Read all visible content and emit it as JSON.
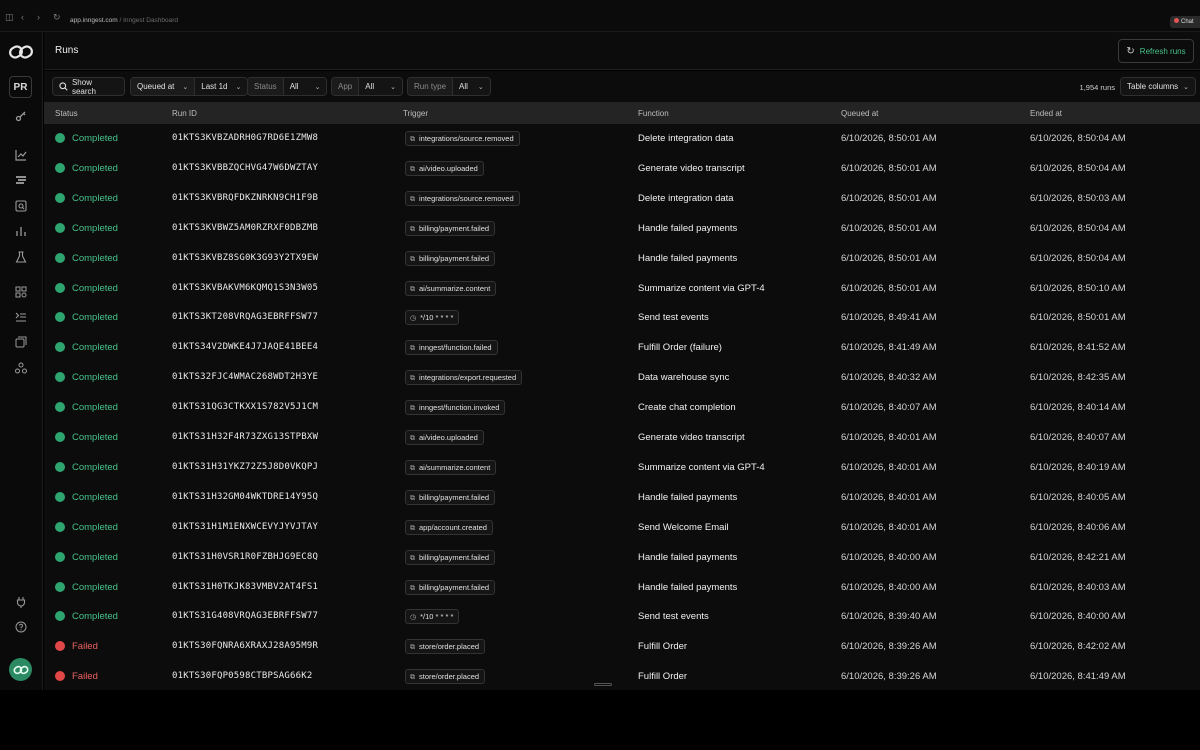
{
  "browser": {
    "url_host": "app.inngest.com",
    "url_sep": " / ",
    "url_title": "Inngest Dashboard",
    "extension_label": "Chat"
  },
  "sidebar": {
    "org_initials": "PR"
  },
  "header": {
    "title": "Runs",
    "refresh_label": "Refresh runs"
  },
  "filters": {
    "show_search": "Show search",
    "queued_at": "Queued at",
    "last": "Last 1d",
    "status_label": "Status",
    "status_value": "All",
    "app_label": "App",
    "app_value": "All",
    "run_type_label": "Run type",
    "run_type_value": "All",
    "runs_count": "1,954 runs",
    "table_columns": "Table columns"
  },
  "colors": {
    "completed": "#2ea56f",
    "failed": "#e04848",
    "completed_text": "#47c28b",
    "failed_text": "#ec6262"
  },
  "table": {
    "columns": [
      "Status",
      "Run ID",
      "Trigger",
      "Function",
      "Queued at",
      "Ended at"
    ],
    "rows": [
      {
        "status": "Completed",
        "run_id": "01KTS3KVBZADRH0G7RD6E1ZMW8",
        "trigger": "integrations/source.removed",
        "trigger_type": "event",
        "function": "Delete integration data",
        "queued": "6/10/2026, 8:50:01 AM",
        "ended": "6/10/2026, 8:50:04 AM"
      },
      {
        "status": "Completed",
        "run_id": "01KTS3KVBBZQCHVG47W6DWZTAY",
        "trigger": "ai/video.uploaded",
        "trigger_type": "event",
        "function": "Generate video transcript",
        "queued": "6/10/2026, 8:50:01 AM",
        "ended": "6/10/2026, 8:50:04 AM"
      },
      {
        "status": "Completed",
        "run_id": "01KTS3KVBRQFDKZNRKN9CH1F9B",
        "trigger": "integrations/source.removed",
        "trigger_type": "event",
        "function": "Delete integration data",
        "queued": "6/10/2026, 8:50:01 AM",
        "ended": "6/10/2026, 8:50:03 AM"
      },
      {
        "status": "Completed",
        "run_id": "01KTS3KVBWZ5AM0RZRXF0DBZMB",
        "trigger": "billing/payment.failed",
        "trigger_type": "event",
        "function": "Handle failed payments",
        "queued": "6/10/2026, 8:50:01 AM",
        "ended": "6/10/2026, 8:50:04 AM"
      },
      {
        "status": "Completed",
        "run_id": "01KTS3KVBZ8SG0K3G93Y2TX9EW",
        "trigger": "billing/payment.failed",
        "trigger_type": "event",
        "function": "Handle failed payments",
        "queued": "6/10/2026, 8:50:01 AM",
        "ended": "6/10/2026, 8:50:04 AM"
      },
      {
        "status": "Completed",
        "run_id": "01KTS3KVBAKVM6KQMQ1S3N3W05",
        "trigger": "ai/summarize.content",
        "trigger_type": "event",
        "function": "Summarize content via GPT-4",
        "queued": "6/10/2026, 8:50:01 AM",
        "ended": "6/10/2026, 8:50:10 AM"
      },
      {
        "status": "Completed",
        "run_id": "01KTS3KT208VRQAG3EBRFFSW77",
        "trigger": "*/10 * * * *",
        "trigger_type": "cron",
        "function": "Send test events",
        "queued": "6/10/2026, 8:49:41 AM",
        "ended": "6/10/2026, 8:50:01 AM"
      },
      {
        "status": "Completed",
        "run_id": "01KTS34V2DWKE4J7JAQE41BEE4",
        "trigger": "inngest/function.failed",
        "trigger_type": "event",
        "function": "Fulfill Order (failure)",
        "queued": "6/10/2026, 8:41:49 AM",
        "ended": "6/10/2026, 8:41:52 AM"
      },
      {
        "status": "Completed",
        "run_id": "01KTS32FJC4WMAC268WDT2H3YE",
        "trigger": "integrations/export.requested",
        "trigger_type": "event",
        "function": "Data warehouse sync",
        "queued": "6/10/2026, 8:40:32 AM",
        "ended": "6/10/2026, 8:42:35 AM"
      },
      {
        "status": "Completed",
        "run_id": "01KTS31QG3CTKXX1S782V5J1CM",
        "trigger": "inngest/function.invoked",
        "trigger_type": "event",
        "function": "Create chat completion",
        "queued": "6/10/2026, 8:40:07 AM",
        "ended": "6/10/2026, 8:40:14 AM"
      },
      {
        "status": "Completed",
        "run_id": "01KTS31H32F4R73ZXG13STPBXW",
        "trigger": "ai/video.uploaded",
        "trigger_type": "event",
        "function": "Generate video transcript",
        "queued": "6/10/2026, 8:40:01 AM",
        "ended": "6/10/2026, 8:40:07 AM"
      },
      {
        "status": "Completed",
        "run_id": "01KTS31H31YKZ72Z5J8D0VKQPJ",
        "trigger": "ai/summarize.content",
        "trigger_type": "event",
        "function": "Summarize content via GPT-4",
        "queued": "6/10/2026, 8:40:01 AM",
        "ended": "6/10/2026, 8:40:19 AM"
      },
      {
        "status": "Completed",
        "run_id": "01KTS31H32GM04WKTDRE14Y95Q",
        "trigger": "billing/payment.failed",
        "trigger_type": "event",
        "function": "Handle failed payments",
        "queued": "6/10/2026, 8:40:01 AM",
        "ended": "6/10/2026, 8:40:05 AM"
      },
      {
        "status": "Completed",
        "run_id": "01KTS31H1M1ENXWCEVYJYVJTAY",
        "trigger": "app/account.created",
        "trigger_type": "event",
        "function": "Send Welcome Email",
        "queued": "6/10/2026, 8:40:01 AM",
        "ended": "6/10/2026, 8:40:06 AM"
      },
      {
        "status": "Completed",
        "run_id": "01KTS31H0VSR1R0FZBHJG9EC8Q",
        "trigger": "billing/payment.failed",
        "trigger_type": "event",
        "function": "Handle failed payments",
        "queued": "6/10/2026, 8:40:00 AM",
        "ended": "6/10/2026, 8:42:21 AM"
      },
      {
        "status": "Completed",
        "run_id": "01KTS31H0TKJK83VMBV2AT4FS1",
        "trigger": "billing/payment.failed",
        "trigger_type": "event",
        "function": "Handle failed payments",
        "queued": "6/10/2026, 8:40:00 AM",
        "ended": "6/10/2026, 8:40:03 AM"
      },
      {
        "status": "Completed",
        "run_id": "01KTS31G408VRQAG3EBRFFSW77",
        "trigger": "*/10 * * * *",
        "trigger_type": "cron",
        "function": "Send test events",
        "queued": "6/10/2026, 8:39:40 AM",
        "ended": "6/10/2026, 8:40:00 AM"
      },
      {
        "status": "Failed",
        "run_id": "01KTS30FQNRA6XRAXJ28A95M9R",
        "trigger": "store/order.placed",
        "trigger_type": "event",
        "function": "Fulfill Order",
        "queued": "6/10/2026, 8:39:26 AM",
        "ended": "6/10/2026, 8:42:02 AM"
      },
      {
        "status": "Failed",
        "run_id": "01KTS30FQP0598CTBPSAG66K2",
        "trigger": "store/order.placed",
        "trigger_type": "event",
        "function": "Fulfill Order",
        "queued": "6/10/2026, 8:39:26 AM",
        "ended": "6/10/2026, 8:41:49 AM"
      }
    ]
  }
}
